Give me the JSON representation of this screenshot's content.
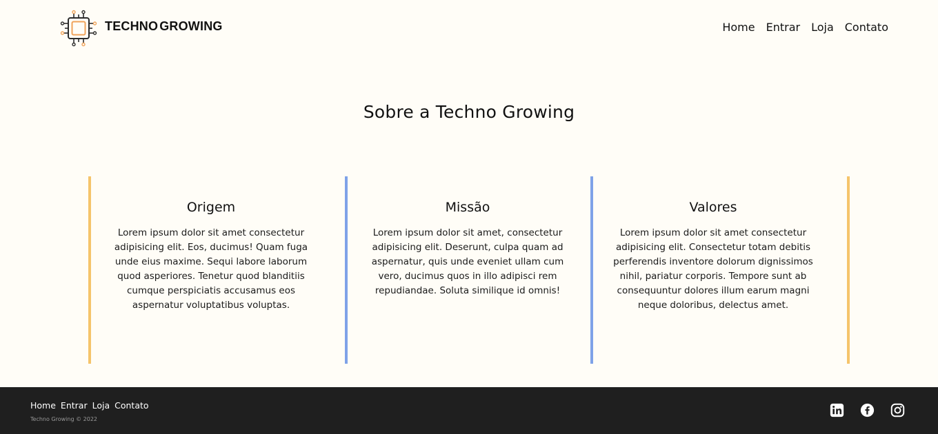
{
  "header": {
    "brand_word1": "TECHNO",
    "brand_word2": "GROWING",
    "nav": [
      "Home",
      "Entrar",
      "Loja",
      "Contato"
    ]
  },
  "main": {
    "title": "Sobre a Techno Growing",
    "cards": [
      {
        "title": "Origem",
        "text": "Lorem ipsum dolor sit amet consectetur adipisicing elit. Eos, ducimus! Quam fuga unde eius maxime. Sequi labore laborum quod asperiores. Tenetur quod blanditiis cumque perspiciatis accusamus eos aspernatur voluptatibus voluptas.",
        "accent": "#f5c46b"
      },
      {
        "title": "Missão",
        "text": "Lorem ipsum dolor sit amet, consectetur adipisicing elit. Deserunt, culpa quam ad aspernatur, quis unde eveniet ullam cum vero, ducimus quos in illo adipisci rem repudiandae. Soluta similique id omnis!",
        "accent": "#7fa2e8"
      },
      {
        "title": "Valores",
        "text": "Lorem ipsum dolor sit amet consectetur adipisicing elit. Consectetur totam debitis perferendis inventore dolorum dignissimos nihil, pariatur corporis. Tempore sunt ab consequuntur dolores illum earum magni neque doloribus, delectus amet.",
        "accent": "#7fa2e8"
      }
    ],
    "end_accent": "#f5c46b"
  },
  "footer": {
    "nav": [
      "Home",
      "Entrar",
      "Loja",
      "Contato"
    ],
    "copyright": "Techno Growing © 2022",
    "social_icons": [
      "linkedin-icon",
      "facebook-icon",
      "instagram-icon"
    ]
  },
  "colors": {
    "background": "#fffdf7",
    "footer_bg": "#1f1f1f",
    "logo_accent": "#f0a35a"
  }
}
